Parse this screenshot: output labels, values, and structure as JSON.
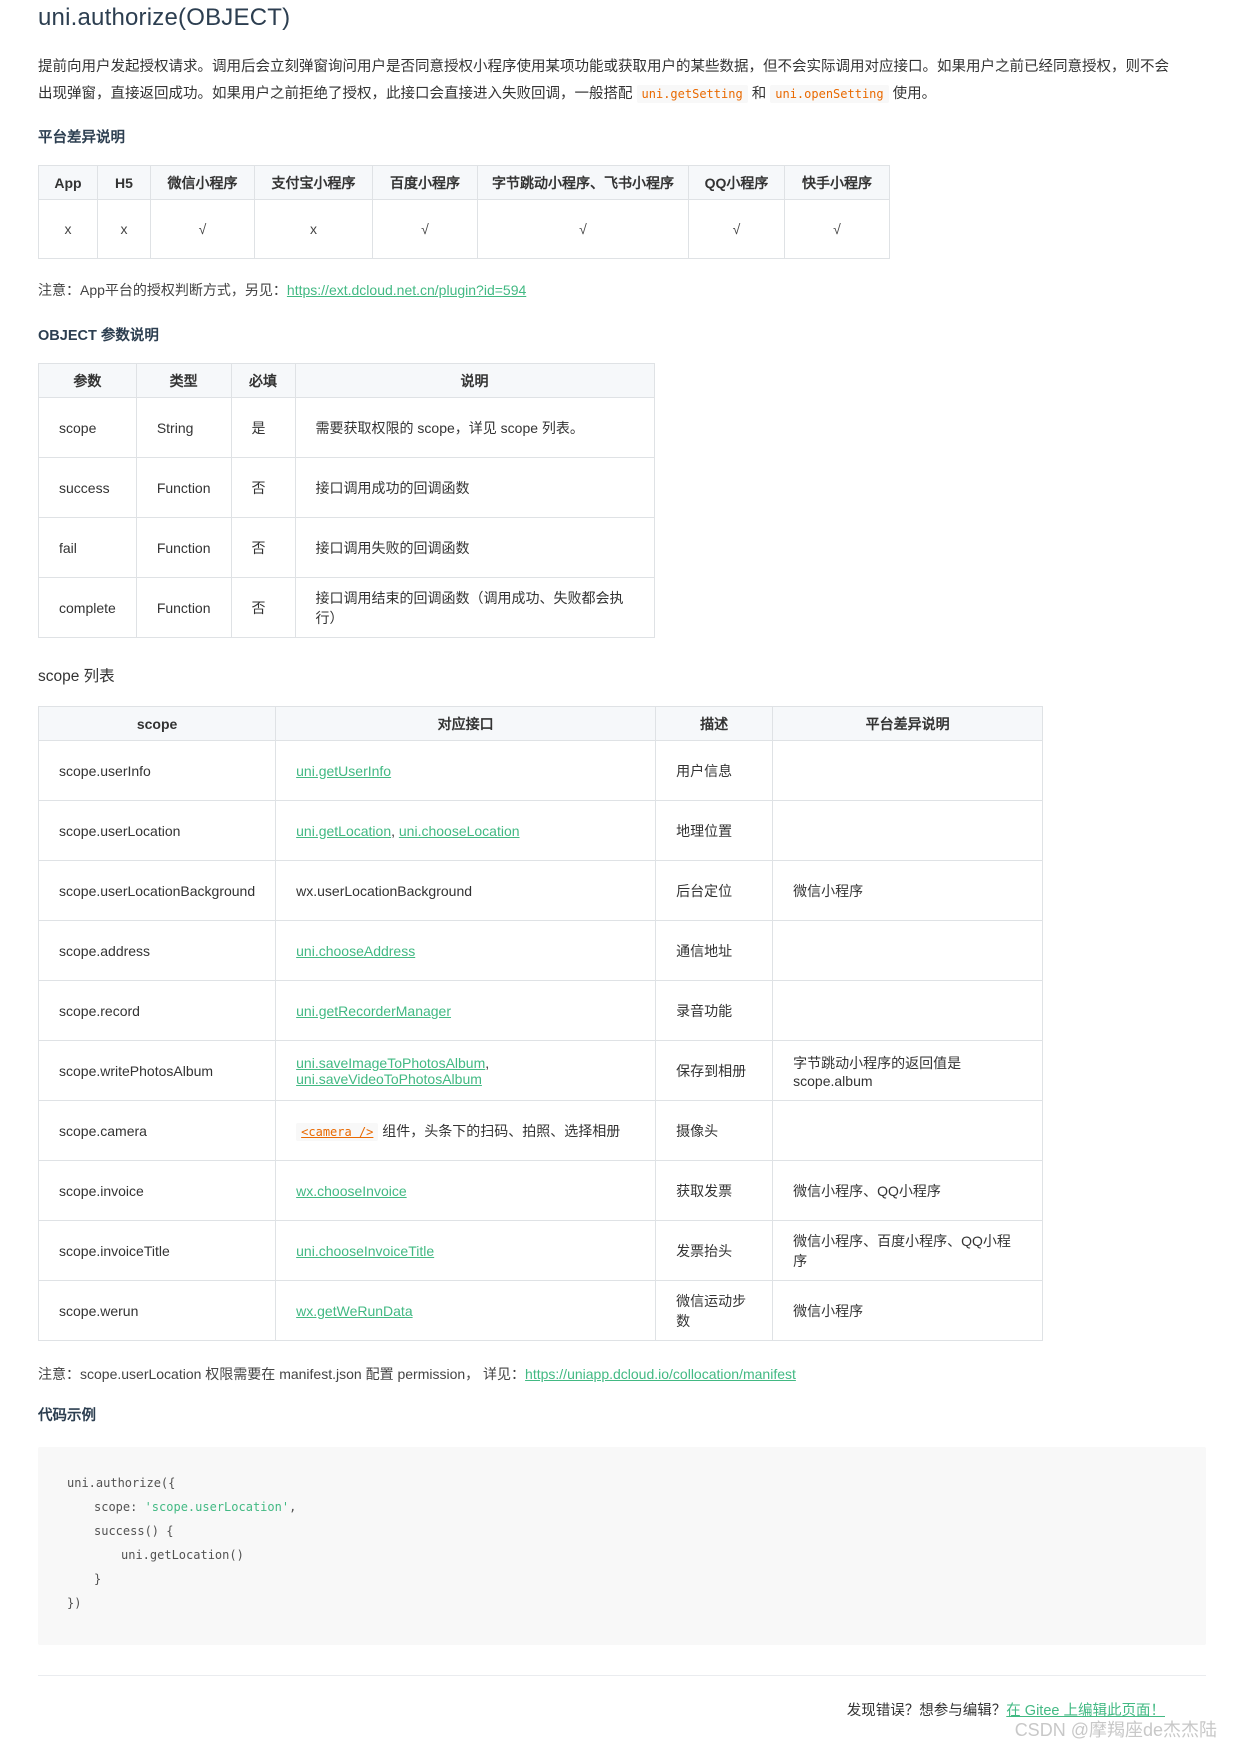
{
  "title": "uni.authorize(OBJECT)",
  "intro": {
    "line1": "提前向用户发起授权请求。调用后会立刻弹窗询问用户是否同意授权小程序使用某项功能或获取用户的某些数据，但不会实际调用对应接口。如果用户之前已经同意授权，则不会",
    "line2_a": "出现弹窗，直接返回成功。如果用户之前拒绝了授权，此接口会直接进入失败回调，一般搭配",
    "code1": "uni.getSetting",
    "line2_b": "和",
    "code2": "uni.openSetting",
    "line2_c": "使用。"
  },
  "platform_section": {
    "heading": "平台差异说明",
    "headers": [
      "App",
      "H5",
      "微信小程序",
      "支付宝小程序",
      "百度小程序",
      "字节跳动小程序、飞书小程序",
      "QQ小程序",
      "快手小程序"
    ],
    "values": [
      "x",
      "x",
      "√",
      "x",
      "√",
      "√",
      "√",
      "√"
    ]
  },
  "note1": {
    "text": "注意：App平台的授权判断方式，另见：",
    "link": "https://ext.dcloud.net.cn/plugin?id=594"
  },
  "param_section": {
    "heading": "OBJECT 参数说明",
    "headers": [
      "参数",
      "类型",
      "必填",
      "说明"
    ],
    "rows": [
      [
        "scope",
        "String",
        "是",
        "需要获取权限的 scope，详见 scope 列表。"
      ],
      [
        "success",
        "Function",
        "否",
        "接口调用成功的回调函数"
      ],
      [
        "fail",
        "Function",
        "否",
        "接口调用失败的回调函数"
      ],
      [
        "complete",
        "Function",
        "否",
        "接口调用结束的回调函数（调用成功、失败都会执行）"
      ]
    ]
  },
  "scope_section": {
    "heading": "scope 列表",
    "headers": [
      "scope",
      "对应接口",
      "描述",
      "平台差异说明"
    ],
    "rows": [
      {
        "scope": "scope.userInfo",
        "api": [
          "uni.getUserInfo"
        ],
        "desc": "用户信息",
        "platform": ""
      },
      {
        "scope": "scope.userLocation",
        "api": [
          "uni.getLocation",
          "uni.chooseLocation"
        ],
        "desc": "地理位置",
        "platform": ""
      },
      {
        "scope": "scope.userLocationBackground",
        "api_plain": "wx.userLocationBackground",
        "desc": "后台定位",
        "platform": "微信小程序"
      },
      {
        "scope": "scope.address",
        "api": [
          "uni.chooseAddress"
        ],
        "desc": "通信地址",
        "platform": ""
      },
      {
        "scope": "scope.record",
        "api": [
          "uni.getRecorderManager"
        ],
        "desc": "录音功能",
        "platform": ""
      },
      {
        "scope": "scope.writePhotosAlbum",
        "api": [
          "uni.saveImageToPhotosAlbum",
          "uni.saveVideoToPhotosAlbum"
        ],
        "desc": "保存到相册",
        "platform": "字节跳动小程序的返回值是scope.album"
      },
      {
        "scope": "scope.camera",
        "api_code": "<camera />",
        "api_text": "组件，头条下的扫码、拍照、选择相册",
        "desc": "摄像头",
        "platform": ""
      },
      {
        "scope": "scope.invoice",
        "api": [
          "wx.chooseInvoice"
        ],
        "desc": "获取发票",
        "platform": "微信小程序、QQ小程序"
      },
      {
        "scope": "scope.invoiceTitle",
        "api": [
          "uni.chooseInvoiceTitle"
        ],
        "desc": "发票抬头",
        "platform": "微信小程序、百度小程序、QQ小程序"
      },
      {
        "scope": "scope.werun",
        "api": [
          "wx.getWeRunData"
        ],
        "desc": "微信运动步数",
        "platform": "微信小程序"
      }
    ]
  },
  "note2": {
    "text": "注意：scope.userLocation 权限需要在 manifest.json 配置 permission， 详见：",
    "link": "https://uniapp.dcloud.io/collocation/manifest"
  },
  "code_section": {
    "heading": "代码示例",
    "lines": [
      {
        "indent": 0,
        "text": "uni.authorize({",
        "str": ""
      },
      {
        "indent": 1,
        "text": "scope: ",
        "str": "'scope.userLocation'",
        "tail": ","
      },
      {
        "indent": 1,
        "text": "success() {",
        "str": ""
      },
      {
        "indent": 2,
        "text": "uni.getLocation()",
        "str": ""
      },
      {
        "indent": 1,
        "text": "}",
        "str": ""
      },
      {
        "indent": 0,
        "text": "})",
        "str": ""
      }
    ]
  },
  "footer": {
    "text": "发现错误？想参与编辑？",
    "link": "在 Gitee 上编辑此页面！"
  },
  "watermark": "CSDN @摩羯座de杰杰陆",
  "colors": {
    "link": "#42b983",
    "inline_code": "#e96900",
    "table_header_bg": "#f6f8fa",
    "border": "#dfe2e5"
  }
}
